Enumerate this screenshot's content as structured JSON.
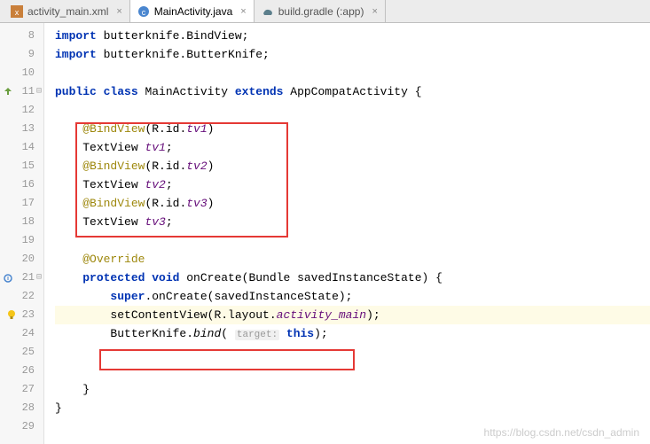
{
  "tabs": [
    {
      "label": "activity_main.xml",
      "icon": "xml",
      "active": false
    },
    {
      "label": "MainActivity.java",
      "icon": "java",
      "active": true
    },
    {
      "label": "build.gradle (:app)",
      "icon": "gradle",
      "active": false
    }
  ],
  "lines": {
    "l8": {
      "num": "8",
      "indent": "    ",
      "tokens": [
        [
          "kw",
          "import"
        ],
        [
          "",
          ", butterknife.BindView;"
        ]
      ],
      "text_a": "import",
      "text_b": " butterknife.BindView;"
    },
    "l9": {
      "num": "9",
      "text_a": "import",
      "text_b": " butterknife.ButterKnife;"
    },
    "l10": {
      "num": "10"
    },
    "l11": {
      "num": "11",
      "pub": "public",
      "cls": "class",
      "name": " MainActivity ",
      "ext": "extends",
      "sup": " AppCompatActivity {"
    },
    "l12": {
      "num": "12"
    },
    "l13": {
      "num": "13",
      "ann": "@BindView",
      "args": "(R.id.",
      "fld": "tv1",
      "close": ")"
    },
    "l14": {
      "num": "14",
      "type": "TextView ",
      "fld": "tv1",
      "semi": ";"
    },
    "l15": {
      "num": "15",
      "ann": "@BindView",
      "args": "(R.id.",
      "fld": "tv2",
      "close": ")"
    },
    "l16": {
      "num": "16",
      "type": "TextView ",
      "fld": "tv2",
      "semi": ";"
    },
    "l17": {
      "num": "17",
      "ann": "@BindView",
      "args": "(R.id.",
      "fld": "tv3",
      "close": ")"
    },
    "l18": {
      "num": "18",
      "type": "TextView ",
      "fld": "tv3",
      "semi": ";"
    },
    "l19": {
      "num": "19"
    },
    "l20": {
      "num": "20",
      "ann": "@Override"
    },
    "l21": {
      "num": "21",
      "prot": "protected",
      "void": " void",
      "meth": " onCreate(Bundle savedInstanceState) {"
    },
    "l22": {
      "num": "22",
      "sup": "super",
      "rest": ".onCreate(savedInstanceState);"
    },
    "l23": {
      "num": "23",
      "call": "setContentView(R.layout.",
      "res": "activity_main",
      "close": ");"
    },
    "l24": {
      "num": "24",
      "cls": "ButterKnife.",
      "bind": "bind",
      "paren": "( ",
      "hint": "target:",
      "thiskw": " this",
      "end": ");"
    },
    "l25": {
      "num": "25"
    },
    "l26": {
      "num": "26"
    },
    "l27": {
      "num": "27",
      "brace": "}"
    },
    "l28": {
      "num": "28",
      "brace": "}"
    },
    "l29": {
      "num": "29"
    }
  },
  "watermark": "https://blog.csdn.net/csdn_admin"
}
